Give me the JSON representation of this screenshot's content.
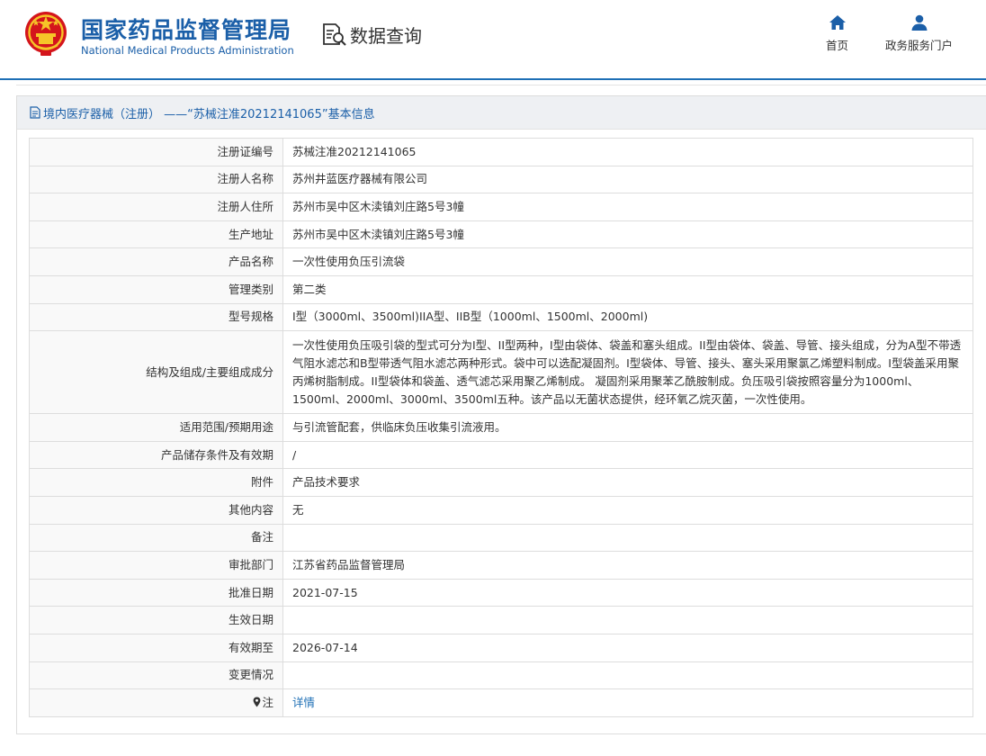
{
  "header": {
    "title_cn": "国家药品监督管理局",
    "title_en": "National Medical Products Administration",
    "query_label": "数据查询",
    "nav": [
      {
        "label": "首页",
        "icon": "home-icon"
      },
      {
        "label": "政务服务门户",
        "icon": "user-icon"
      }
    ]
  },
  "panel": {
    "title": "境内医疗器械（注册） ——“苏械注准20212141065”基本信息"
  },
  "rows": [
    {
      "label": "注册证编号",
      "value": "苏械注准20212141065"
    },
    {
      "label": "注册人名称",
      "value": "苏州井蓝医疗器械有限公司"
    },
    {
      "label": "注册人住所",
      "value": "苏州市吴中区木渎镇刘庄路5号3幢"
    },
    {
      "label": "生产地址",
      "value": "苏州市吴中区木渎镇刘庄路5号3幢"
    },
    {
      "label": "产品名称",
      "value": "一次性使用负压引流袋"
    },
    {
      "label": "管理类别",
      "value": "第二类"
    },
    {
      "label": "型号规格",
      "value": "I型（3000ml、3500ml)IIA型、IIB型（1000ml、1500ml、2000ml)"
    },
    {
      "label": "结构及组成/主要组成成分",
      "value": "一次性使用负压吸引袋的型式可分为I型、II型两种，I型由袋体、袋盖和塞头组成。II型由袋体、袋盖、导管、接头组成，分为A型不带透气阻水滤芯和B型带透气阻水滤芯两种形式。袋中可以选配凝固剂。I型袋体、导管、接头、塞头采用聚氯乙烯塑料制成。I型袋盖采用聚丙烯树脂制成。II型袋体和袋盖、透气滤芯采用聚乙烯制成。 凝固剂采用聚苯乙酰胺制成。负压吸引袋按照容量分为1000ml、1500ml、2000ml、3000ml、3500ml五种。该产品以无菌状态提供，经环氧乙烷灭菌，一次性使用。"
    },
    {
      "label": "适用范围/预期用途",
      "value": "与引流管配套，供临床负压收集引流液用。"
    },
    {
      "label": "产品储存条件及有效期",
      "value": "/"
    },
    {
      "label": "附件",
      "value": "产品技术要求"
    },
    {
      "label": "其他内容",
      "value": "无"
    },
    {
      "label": "备注",
      "value": ""
    },
    {
      "label": "审批部门",
      "value": "江苏省药品监督管理局"
    },
    {
      "label": "批准日期",
      "value": "2021-07-15"
    },
    {
      "label": "生效日期",
      "value": ""
    },
    {
      "label": "有效期至",
      "value": "2026-07-14"
    },
    {
      "label": "变更情况",
      "value": ""
    },
    {
      "label": "注",
      "value": "详情",
      "icon": "map-pin-icon"
    }
  ]
}
